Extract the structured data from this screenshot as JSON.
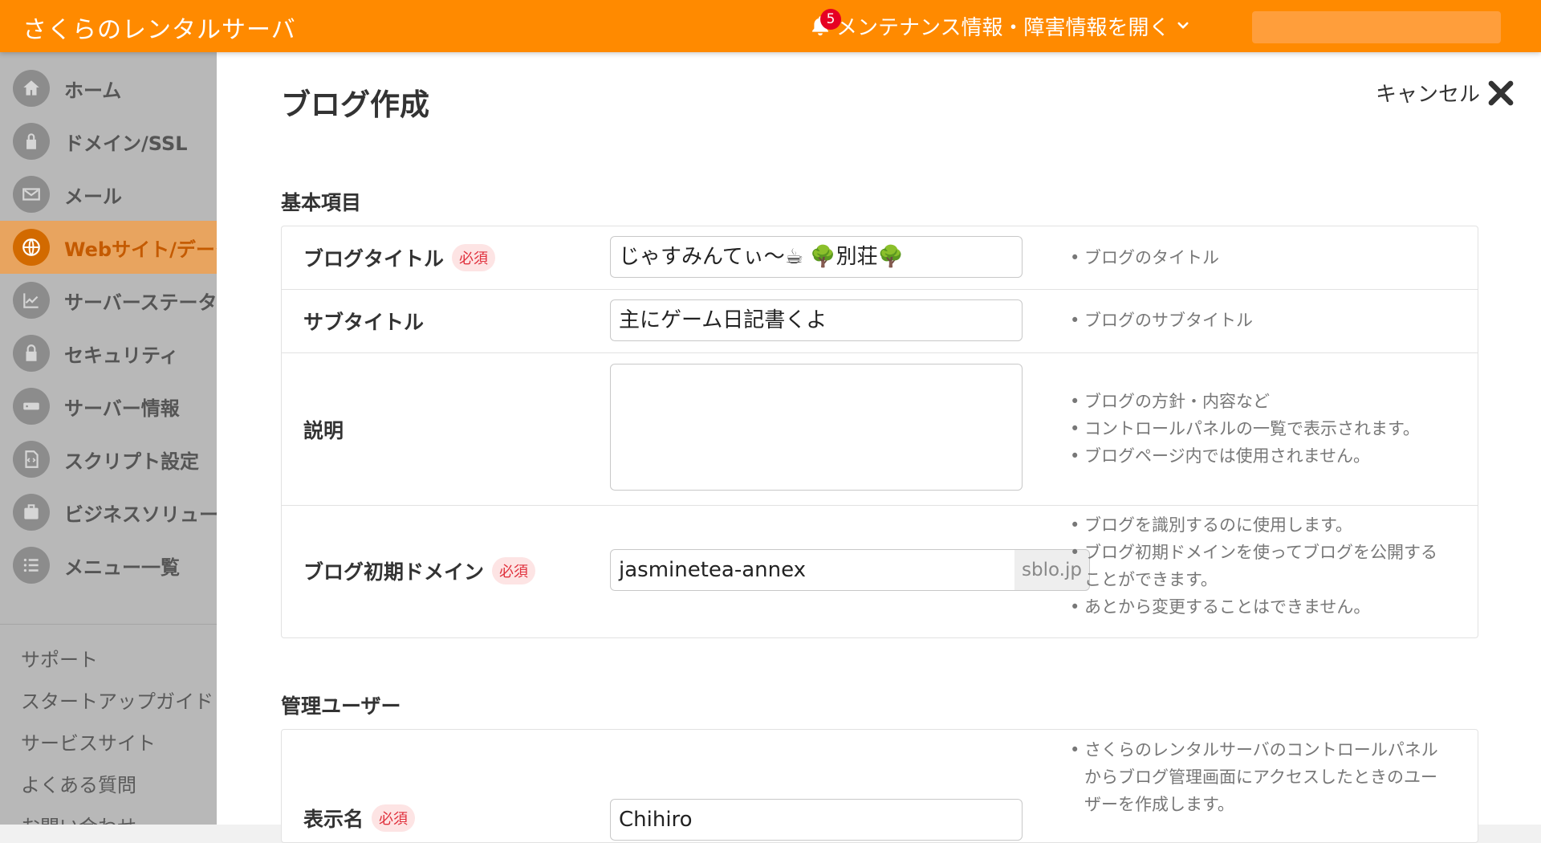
{
  "header": {
    "app_title": "さくらのレンタルサーバ",
    "notification_count": "5",
    "maintenance_label": "メンテナンス情報・障害情報を開く"
  },
  "sidebar": {
    "items": [
      {
        "label": "ホーム",
        "icon": "home-icon"
      },
      {
        "label": "ドメイン/SSL",
        "icon": "domain-lock-icon"
      },
      {
        "label": "メール",
        "icon": "mail-icon"
      },
      {
        "label": "Webサイト/データ",
        "icon": "globe-icon",
        "active": true
      },
      {
        "label": "サーバーステータス",
        "icon": "chart-icon"
      },
      {
        "label": "セキュリティ",
        "icon": "lock-icon"
      },
      {
        "label": "サーバー情報",
        "icon": "server-icon"
      },
      {
        "label": "スクリプト設定",
        "icon": "script-icon"
      },
      {
        "label": "ビジネスソリューション",
        "icon": "briefcase-icon"
      },
      {
        "label": "メニュー一覧",
        "icon": "list-icon"
      }
    ],
    "links": [
      "サポート",
      "スタートアップガイド",
      "サービスサイト",
      "よくある質問",
      "お問い合わせ"
    ]
  },
  "page": {
    "title": "ブログ作成",
    "cancel_label": "キャンセル"
  },
  "basic": {
    "section_title": "基本項目",
    "required_badge": "必須",
    "blog_title": {
      "label": "ブログタイトル",
      "value": "じゃすみんてぃ〜☕ 🌳別荘🌳",
      "hints": [
        "ブログのタイトル"
      ]
    },
    "subtitle": {
      "label": "サブタイトル",
      "value": "主にゲーム日記書くよ",
      "hints": [
        "ブログのサブタイトル"
      ]
    },
    "description": {
      "label": "説明",
      "value": "",
      "hints": [
        "ブログの方針・内容など",
        "コントロールパネルの一覧で表示されます。",
        "ブログページ内では使用されません。"
      ]
    },
    "domain": {
      "label": "ブログ初期ドメイン",
      "value": "jasminetea-annex",
      "suffix": "sblo.jp",
      "hints": [
        "ブログを識別するのに使用します。",
        "ブログ初期ドメインを使ってブログを公開することができます。",
        "あとから変更することはできません。"
      ]
    }
  },
  "admin": {
    "section_title": "管理ユーザー",
    "display_name": {
      "label": "表示名",
      "value": "Chihiro",
      "hints": [
        "さくらのレンタルサーバのコントロールパネルからブログ管理画面にアクセスしたときのユーザーを作成します。"
      ]
    }
  },
  "colors": {
    "accent": "#ff8a00",
    "badge": "#e0303c",
    "notification": "#e60023"
  }
}
